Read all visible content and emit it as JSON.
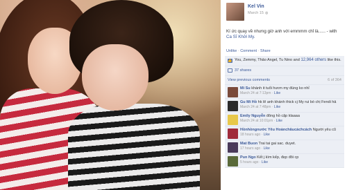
{
  "post": {
    "author": "Kel Vin",
    "date": "March 15",
    "caption": "Kí ức quay về nhưng giờ anh với emmmm chỉ là...... -",
    "with_prefix": "with",
    "tagged": "Ca Sĩ Khởi My.",
    "actions": [
      "Unlike",
      "Comment",
      "Share"
    ],
    "likes_text": "You, Zemmy, Thảo Angel, Tu Nino and",
    "likes_link": "12,964 others",
    "likes_suffix": "like this.",
    "shares": "37 shares",
    "view_previous": "View previous comments",
    "comment_count": "6 of 364"
  },
  "comments": [
    {
      "name": "Mi Su",
      "text": "khánh it tuổi hươn my đúng ko nhỉ",
      "time": "March 24 at 7:13pm",
      "like": "Like"
    },
    {
      "name": "Gu Mi Hồ",
      "text": "hk lẽ anh khánh thick cj My rui bó chị Fendi hả",
      "time": "March 24 at 7:48pm",
      "like": "Like"
    },
    {
      "name": "Emily Nguyễn",
      "text": "đông hồ cặp klaaaa",
      "time": "March 24 at 10:01pm",
      "like": "Like"
    },
    {
      "name": "Hồnhồngnước Yêu Hoànchâucáchcách",
      "text": "Người yêu cũ",
      "time": "18 hours ago",
      "like": "Like"
    },
    {
      "name": "Mat Buon",
      "text": "Trai tai gai sac. duyet.",
      "time": "17 hours ago",
      "like": "Like"
    },
    {
      "name": "Pun Ngo",
      "text": "Kết j kìm kếp, đẹp đôi cp",
      "time": "5 hours ago",
      "like": "Like"
    }
  ],
  "colors": {
    "link": "#3b5998",
    "feedback_bg": "#eceff5",
    "avatars": [
      "#7a4a3a",
      "#2a2a2a",
      "#e8c84a",
      "#a02a3a",
      "#4a3a5a",
      "#5a6a3a"
    ]
  }
}
